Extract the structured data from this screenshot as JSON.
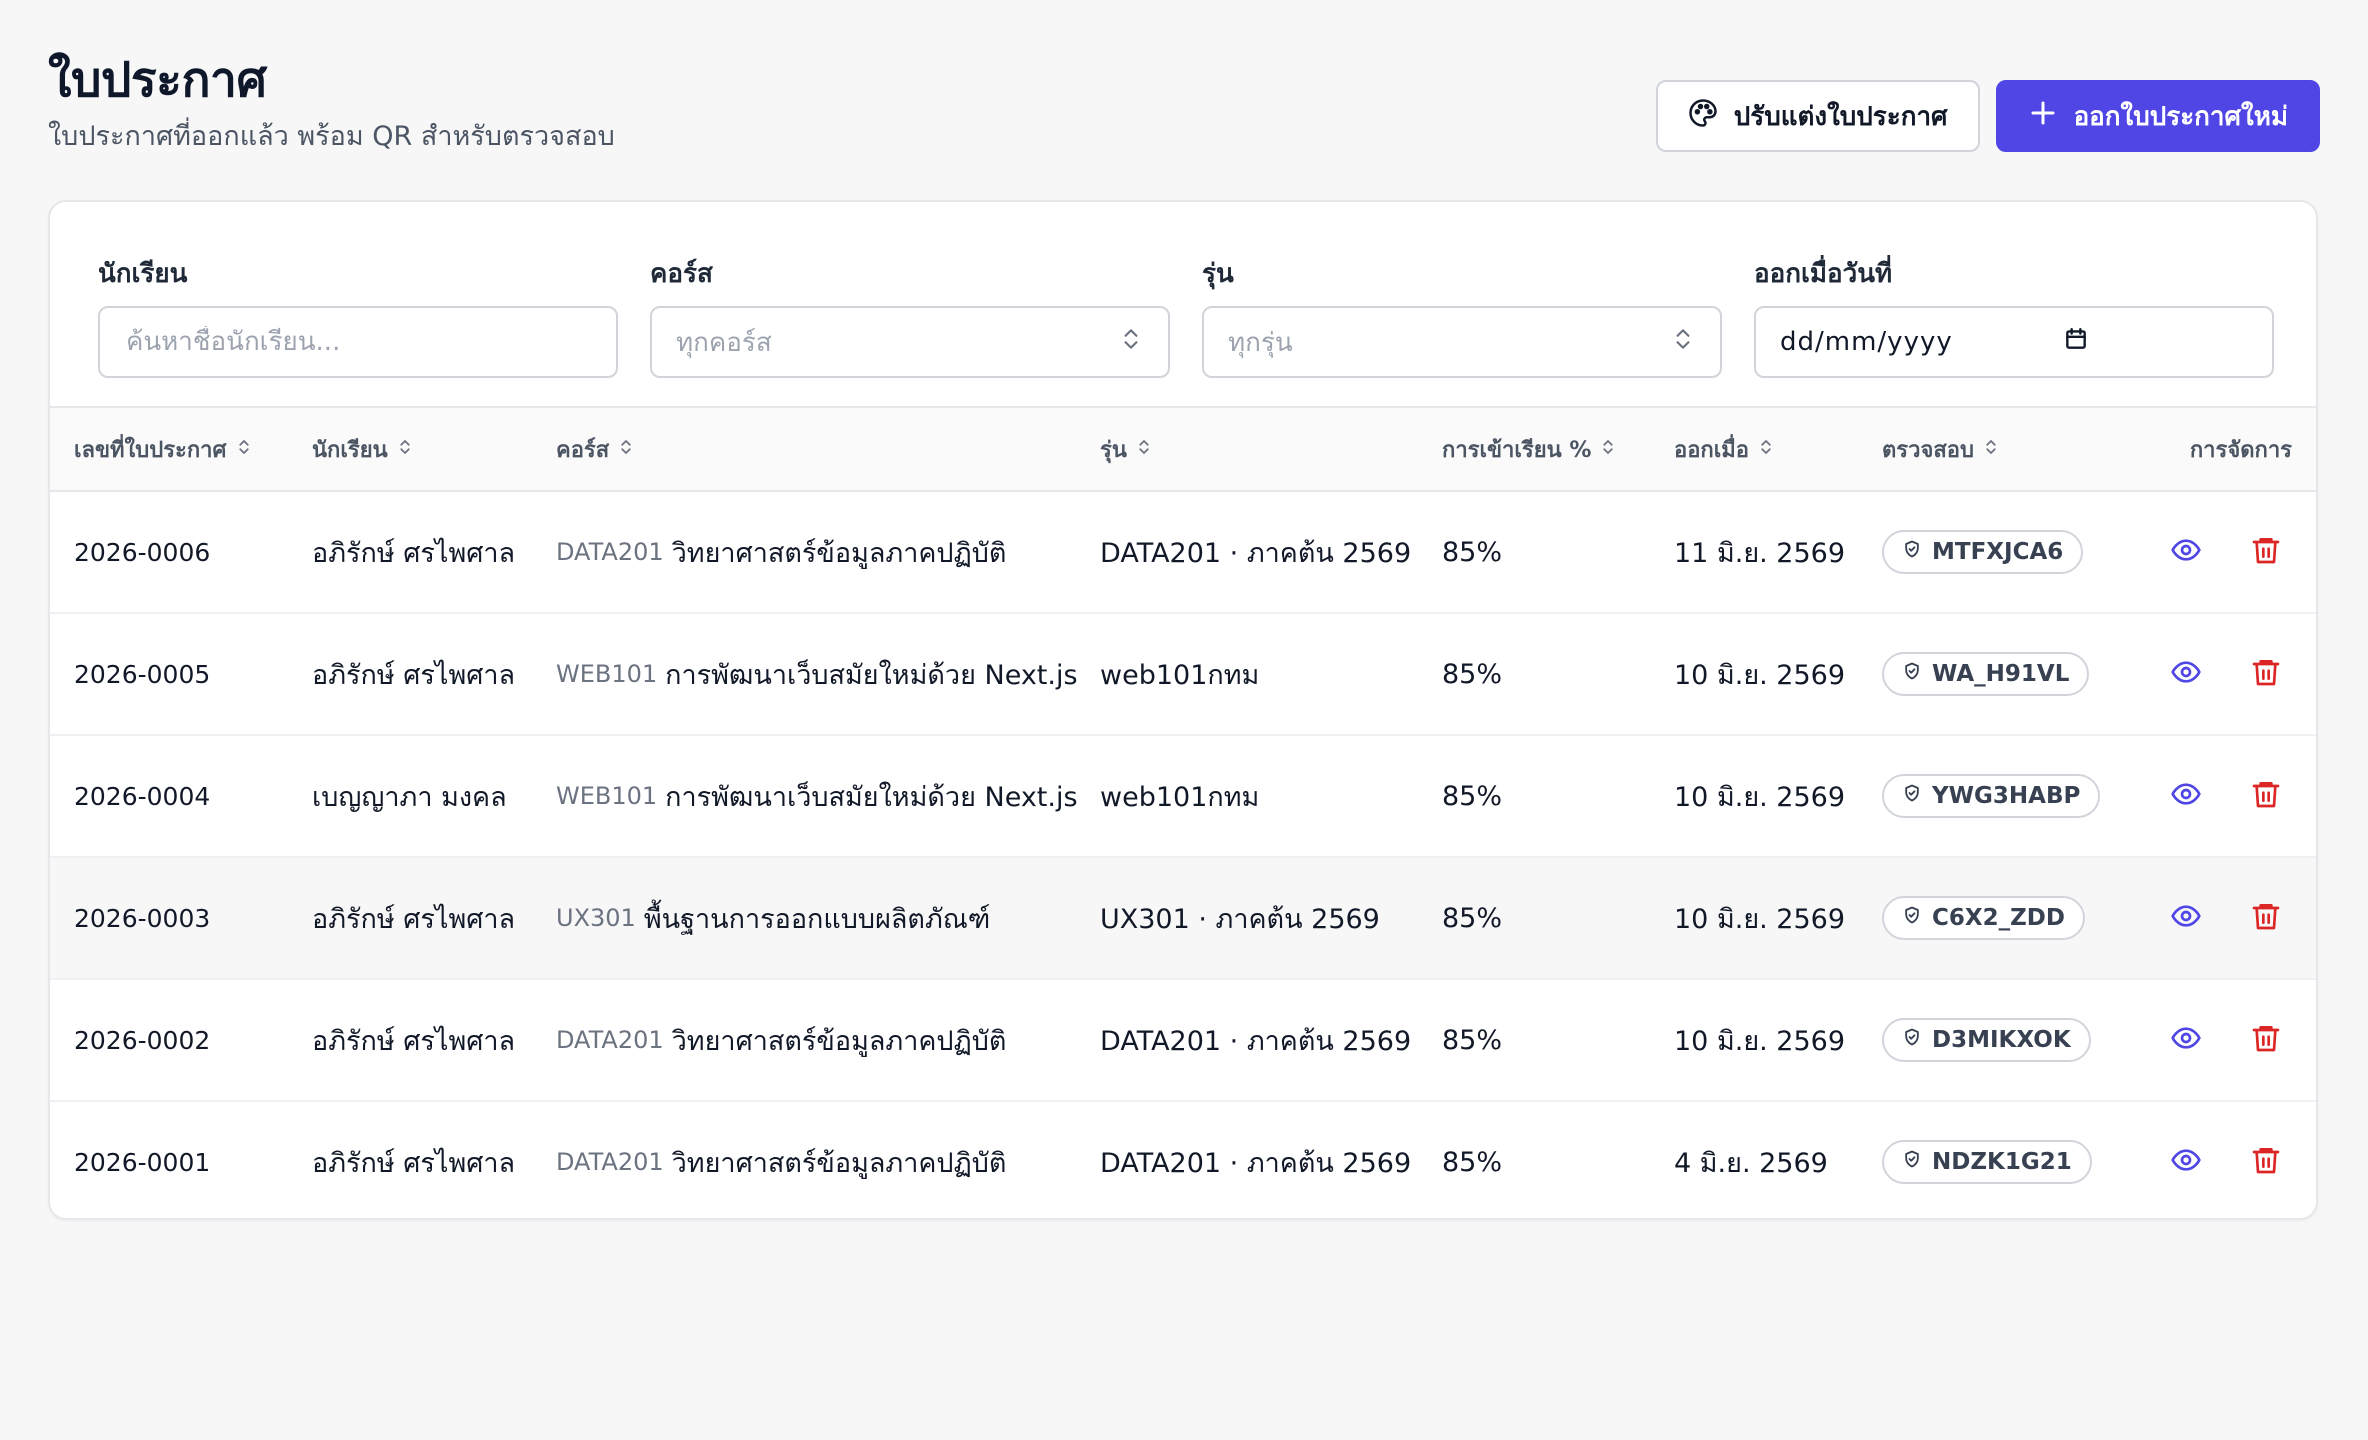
{
  "header": {
    "title": "ใบประกาศ",
    "subtitle": "ใบประกาศที่ออกแล้ว พร้อม QR สำหรับตรวจสอบ",
    "customize_label": "ปรับแต่งใบประกาศ",
    "new_label": "ออกใบประกาศใหม่"
  },
  "filters": {
    "student": {
      "label": "นักเรียน",
      "placeholder": "ค้นหาชื่อนักเรียน..."
    },
    "course": {
      "label": "คอร์ส",
      "value": "ทุกคอร์ส"
    },
    "batch": {
      "label": "รุ่น",
      "value": "ทุกรุ่น"
    },
    "issued": {
      "label": "ออกเมื่อวันที่",
      "value": "dd/mm/yyyy"
    }
  },
  "table": {
    "columns": {
      "number": "เลขที่ใบประกาศ",
      "student": "นักเรียน",
      "course": "คอร์ส",
      "batch": "รุ่น",
      "attendance": "การเข้าเรียน %",
      "issued": "ออกเมื่อ",
      "verify": "ตรวจสอบ",
      "actions": "การจัดการ"
    },
    "rows": [
      {
        "number": "2026-0006",
        "student": "อภิรักษ์ ศรไพศาล",
        "course_code": "DATA201",
        "course_name": "วิทยาศาสตร์ข้อมูลภาคปฏิบัติ",
        "batch": "DATA201 · ภาคต้น 2569",
        "attendance": "85%",
        "issued": "11 มิ.ย. 2569",
        "verify": "MTFXJCA6"
      },
      {
        "number": "2026-0005",
        "student": "อภิรักษ์ ศรไพศาล",
        "course_code": "WEB101",
        "course_name": "การพัฒนาเว็บสมัยใหม่ด้วย Next.js",
        "batch": "web101กทม",
        "attendance": "85%",
        "issued": "10 มิ.ย. 2569",
        "verify": "WA_H91VL"
      },
      {
        "number": "2026-0004",
        "student": "เบญญาภา มงคล",
        "course_code": "WEB101",
        "course_name": "การพัฒนาเว็บสมัยใหม่ด้วย Next.js",
        "batch": "web101กทม",
        "attendance": "85%",
        "issued": "10 มิ.ย. 2569",
        "verify": "YWG3HABP"
      },
      {
        "number": "2026-0003",
        "student": "อภิรักษ์ ศรไพศาล",
        "course_code": "UX301",
        "course_name": "พื้นฐานการออกแบบผลิตภัณฑ์",
        "batch": "UX301 · ภาคต้น 2569",
        "attendance": "85%",
        "issued": "10 มิ.ย. 2569",
        "verify": "C6X2_ZDD"
      },
      {
        "number": "2026-0002",
        "student": "อภิรักษ์ ศรไพศาล",
        "course_code": "DATA201",
        "course_name": "วิทยาศาสตร์ข้อมูลภาคปฏิบัติ",
        "batch": "DATA201 · ภาคต้น 2569",
        "attendance": "85%",
        "issued": "10 มิ.ย. 2569",
        "verify": "D3MIKXOK"
      },
      {
        "number": "2026-0001",
        "student": "อภิรักษ์ ศรไพศาล",
        "course_code": "DATA201",
        "course_name": "วิทยาศาสตร์ข้อมูลภาคปฏิบัติ",
        "batch": "DATA201 · ภาคต้น 2569",
        "attendance": "85%",
        "issued": "4 มิ.ย. 2569",
        "verify": "NDZK1G21"
      }
    ]
  },
  "icons": {
    "customize": "palette-icon",
    "new": "plus-icon",
    "select": "chevron-up-down-icon",
    "date": "calendar-icon",
    "sort": "sort-icon",
    "verify": "shield-check-icon",
    "view": "eye-icon",
    "delete": "trash-icon"
  },
  "colors": {
    "primary": "#4f46e5",
    "view_icon": "#4f46e5",
    "delete_icon": "#dc2626",
    "background": "#f7f7f8"
  }
}
